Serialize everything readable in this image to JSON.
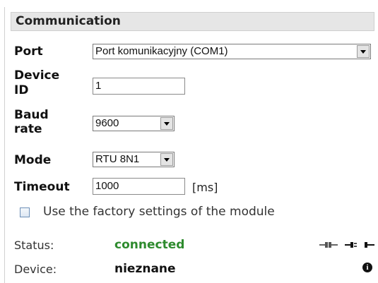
{
  "section": {
    "title": "Communication"
  },
  "port": {
    "label": "Port",
    "value": "Port komunikacyjny (COM1)"
  },
  "device_id": {
    "label_line1": "Device",
    "label_line2": "ID",
    "value": "1"
  },
  "baud": {
    "label_line1": "Baud",
    "label_line2": "rate",
    "value": "9600"
  },
  "mode": {
    "label": "Mode",
    "value": "RTU 8N1"
  },
  "timeout": {
    "label": "Timeout",
    "value": "1000",
    "unit": "[ms]"
  },
  "factory": {
    "label": "Use the factory settings of the module",
    "checked": false
  },
  "status": {
    "label": "Status:",
    "value": "connected",
    "value_color": "#2e8b2e"
  },
  "device": {
    "label": "Device:",
    "value": "nieznane"
  },
  "icons": {
    "connect": "plug-connected-icon",
    "disconnect": "plug-disconnect-icon",
    "info": "info-icon"
  }
}
